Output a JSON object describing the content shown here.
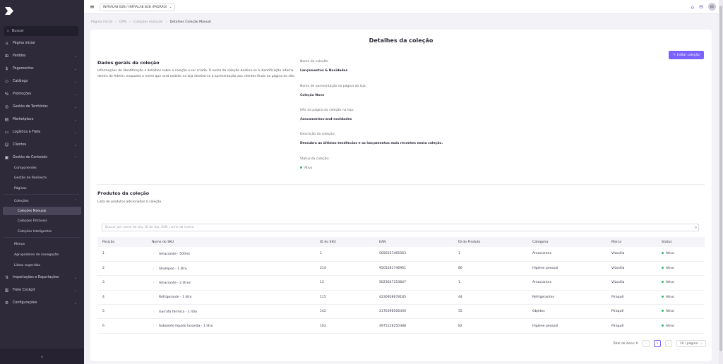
{
  "sidebar": {
    "search": "Buscar",
    "items": [
      {
        "label": "Página inicial",
        "icon": "home-icon",
        "chev": false
      },
      {
        "label": "Pedidos",
        "icon": "cart-icon",
        "chev": true
      },
      {
        "label": "Pagamentos",
        "icon": "dollar-icon",
        "chev": true
      },
      {
        "label": "Catálogo",
        "icon": "tag-icon",
        "chev": true
      },
      {
        "label": "Promoções",
        "icon": "percent-icon",
        "chev": true
      },
      {
        "label": "Gestão de Territórios",
        "icon": "globe-icon",
        "chev": true
      },
      {
        "label": "Marketplace",
        "icon": "store-icon",
        "chev": true
      },
      {
        "label": "Logística e Frete",
        "icon": "truck-icon",
        "chev": true
      },
      {
        "label": "Clientes",
        "icon": "users-icon",
        "chev": true
      },
      {
        "label": "Gestão de Conteúdo",
        "icon": "content-icon",
        "chev": true
      }
    ],
    "content_sub": [
      "Componentes",
      "Gestão de Redirects",
      "Páginas"
    ],
    "colecoes": "Coleções",
    "colecoes_sub": [
      "Coleções Manuais",
      "Coleções Filtráveis",
      "Coleções Inteligentes"
    ],
    "content_sub2": [
      "Menus",
      "Agrupadores de navegação",
      "Listas sugeridas"
    ],
    "bottom_items": [
      {
        "label": "Importações e Exportações",
        "icon": "import-icon"
      },
      {
        "label": "Frete Cockpit",
        "icon": "chart-icon"
      },
      {
        "label": "Configurações",
        "icon": "gear-icon"
      }
    ]
  },
  "topbar": {
    "store": "INFRALAB B2B / INFRALAB B2B (PADRÃO)",
    "avatar": "BE"
  },
  "breadcrumb": [
    "Página inicial",
    "CMS",
    "Coleções manuais",
    "Detalhes Coleção Manual"
  ],
  "page": {
    "title": "Detalhes da coleção",
    "edit_button": "Editar coleção",
    "general": {
      "heading": "Dados gerais da coleção",
      "description": "Informações de identificação e detalhes sobre a coleção a ser criada. O nome da coleção destina-se à identificação interna dentro do Admin, enquanto o nome que será exibido na loja destina-se à apresentação aos clientes finais na página do site."
    },
    "fields": [
      {
        "label": "Nome da coleção:",
        "value": "Lançamentos & Novidades"
      },
      {
        "label": "Nome de apresentação na página da loja:",
        "value": "Coleção Novo"
      },
      {
        "label": "URL da página da coleção na loja:",
        "value": "/lancamentos-and-novidades"
      },
      {
        "label": "Descrição da coleção:",
        "value": "Descubra as últimas tendências e os lançamentos mais recentes nesta coleção."
      }
    ],
    "status_label": "Status da coleção:",
    "status_value": "Ativo",
    "products": {
      "heading": "Produtos da coleção",
      "description": "Lista de produtos adicionados à coleção.",
      "search_placeholder": "Buscar por nome do sku, ID do sku, EAN, nome da marca",
      "columns": [
        "Posição",
        "Nome do SKU",
        "ID do SKU",
        "EAN",
        "ID do Produto",
        "Categoria",
        "Marca",
        "Status"
      ],
      "rows": [
        [
          "1",
          "Amaciante - 500ml",
          "1",
          "5056237465563",
          "1",
          "Amaciantes",
          "Vitanilla",
          "Ativo"
        ],
        [
          "2",
          "Shampoo - 1 litro",
          "214",
          "9505281746961",
          "86",
          "Higiene pessoal",
          "Vitanilla",
          "Ativo"
        ],
        [
          "3",
          "Amaciante - 2 litros",
          "13",
          "5023647153847",
          "1",
          "Amaciantes",
          "Vitanilla",
          "Ativo"
        ],
        [
          "4",
          "Refrigerante - 1 litro",
          "115",
          "4230958678185",
          "44",
          "Refrigerantes",
          "Piraquê",
          "Ativo"
        ],
        [
          "5",
          "Garrafa térmica - 1 litro",
          "142",
          "2176398506430",
          "55",
          "Objetos",
          "Piraquê",
          "Ativo"
        ],
        [
          "6",
          "Sabonete líquido lavanda - 1 litro",
          "102",
          "4975128250388",
          "82",
          "Higiene pessoal",
          "Piraquê",
          "Ativo"
        ]
      ]
    },
    "pagination": {
      "total": "Total de itens: 6",
      "page": "1",
      "page_size": "10 / página"
    }
  },
  "colors": {
    "accent": "#7b61ff",
    "sidebar": "#2e2a3a",
    "status_active": "#2fb86b"
  }
}
